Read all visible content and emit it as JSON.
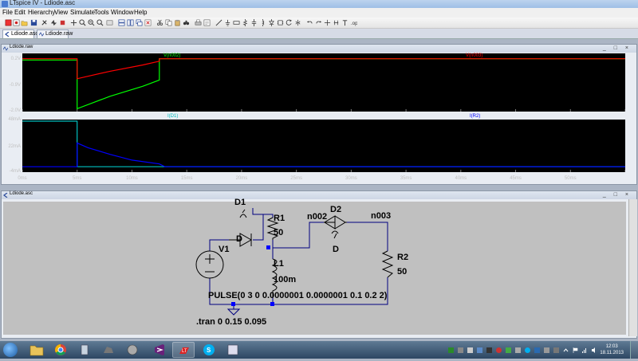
{
  "window": {
    "title": "LTspice IV - Ldiode.asc"
  },
  "menu": [
    "File",
    "Edit",
    "Hierarchy",
    "View",
    "Simulate",
    "Tools",
    "Window",
    "Help"
  ],
  "tabs": [
    {
      "label": "Ldiode.asc",
      "active": true
    },
    {
      "label": "Ldiode.raw",
      "active": false
    }
  ],
  "waveform_window": {
    "title": "Ldiode.raw",
    "pane1": {
      "y_ticks": [
        "0.2V",
        "-0.9V",
        "-2.0V"
      ],
      "traces": [
        {
          "name": "V(n002)",
          "color": "#00ff00"
        },
        {
          "name": "V(n003)",
          "color": "#ff0000"
        }
      ]
    },
    "pane2": {
      "y_ticks": [
        "48mA",
        "22mA",
        "-4mA"
      ],
      "traces": [
        {
          "name": "I(D1)",
          "color": "#00c0c0"
        },
        {
          "name": "I(R2)",
          "color": "#0000ff"
        }
      ]
    },
    "x_ticks": [
      "0ms",
      "5ms",
      "10ms",
      "15ms",
      "20ms",
      "25ms",
      "30ms",
      "35ms",
      "40ms",
      "45ms",
      "50ms"
    ]
  },
  "chart_data": {
    "type": "line",
    "x_unit": "ms",
    "xlim": [
      0,
      55
    ],
    "panes": [
      {
        "ylim": [
          -2.0,
          0.2
        ],
        "y_unit": "V",
        "series": [
          {
            "name": "V(n002)",
            "color": "#00ff00",
            "x": [
              0,
              5,
              5,
              8,
              11,
              12.5,
              12.5,
              55
            ],
            "y": [
              0,
              0,
              -1.95,
              -1.45,
              -1.05,
              -0.8,
              0.05,
              0.05
            ]
          },
          {
            "name": "V(n003)",
            "color": "#ff0000",
            "x": [
              0,
              5,
              5,
              8,
              11,
              12.5,
              12.5,
              55
            ],
            "y": [
              0.05,
              0.05,
              -0.75,
              -0.45,
              -0.2,
              -0.05,
              0.05,
              0.05
            ]
          }
        ]
      },
      {
        "ylim": [
          -4,
          48
        ],
        "y_unit": "mA",
        "series": [
          {
            "name": "I(D1)",
            "color": "#00c0c0",
            "x": [
              0,
              5,
              5,
              55
            ],
            "y": [
              48,
              48,
              0,
              0
            ]
          },
          {
            "name": "I(R2)",
            "color": "#0000ff",
            "x": [
              0,
              5,
              5,
              6,
              8,
              10,
              12.5,
              13,
              55
            ],
            "y": [
              0,
              0,
              25,
              20,
              13,
              7,
              3,
              0,
              0
            ]
          }
        ]
      }
    ]
  },
  "schematic_window": {
    "title": "Ldiode.asc",
    "labels": {
      "d1": "D1",
      "d1_model": "D",
      "r1": "R1",
      "r1_val": "50",
      "v1": "V1",
      "l1": "L1",
      "l1_val": "100m",
      "n002": "n002",
      "d2": "D2",
      "d2_model": "D",
      "n003": "n003",
      "r2": "R2",
      "r2_val": "50",
      "pulse": "PULSE(0 3 0 0.0000001 0.0000001 0.1 0.2 2)",
      "tran": ".tran 0 0.15 0.095"
    }
  },
  "taskbar": {
    "clock_time": "12:03",
    "clock_date": "18.11.2013"
  }
}
